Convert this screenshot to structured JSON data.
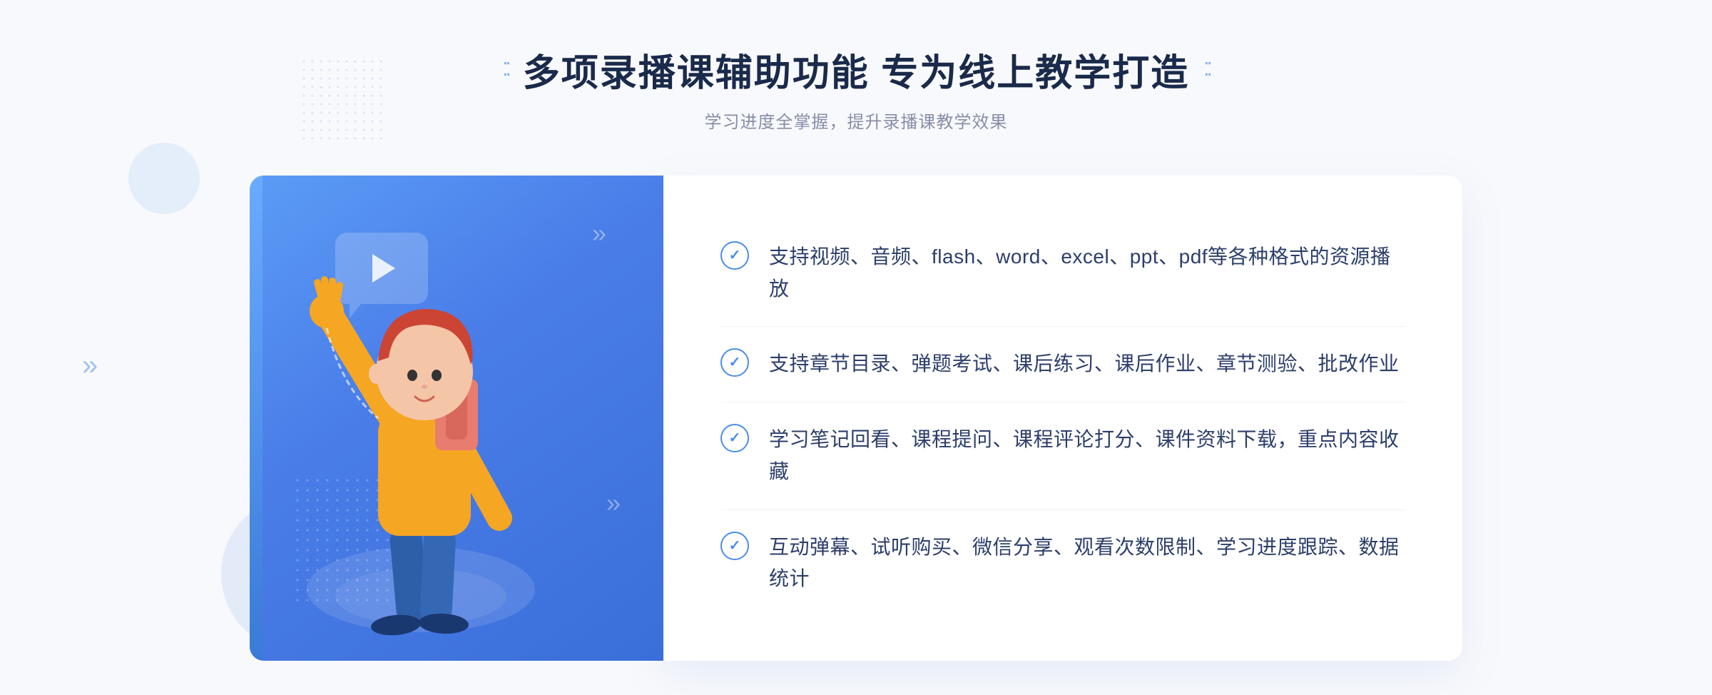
{
  "header": {
    "title_dots_left": "⁚⁚",
    "title_dots_right": "⁚⁚",
    "main_title": "多项录播课辅助功能 专为线上教学打造",
    "sub_title": "学习进度全掌握，提升录播课教学效果"
  },
  "features": [
    {
      "id": 1,
      "text": "支持视频、音频、flash、word、excel、ppt、pdf等各种格式的资源播放"
    },
    {
      "id": 2,
      "text": "支持章节目录、弹题考试、课后练习、课后作业、章节测验、批改作业"
    },
    {
      "id": 3,
      "text": "学习笔记回看、课程提问、课程评论打分、课件资料下载，重点内容收藏"
    },
    {
      "id": 4,
      "text": "互动弹幕、试听购买、微信分享、观看次数限制、学习进度跟踪、数据统计"
    }
  ],
  "colors": {
    "accent_blue": "#4b8de6",
    "title_dark": "#1a2a4a",
    "text_color": "#2c3e6a",
    "subtitle_gray": "#888ea8",
    "gradient_start": "#5b9cf6",
    "gradient_end": "#3a6ed8"
  }
}
